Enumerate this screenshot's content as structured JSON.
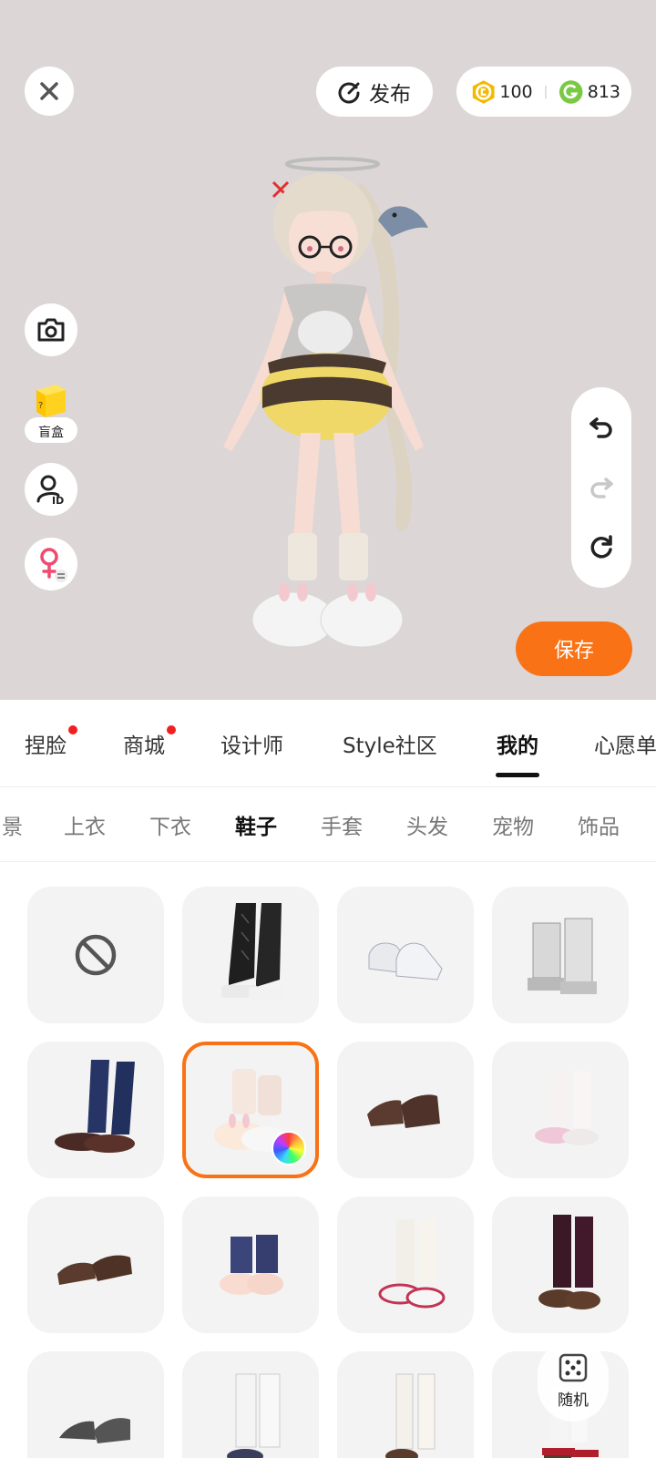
{
  "header": {
    "publish_label": "发布",
    "coin_gold": "100",
    "coin_green": "813"
  },
  "side": {
    "mystery_box_label": "盲盒"
  },
  "save_label": "保存",
  "main_tabs": [
    {
      "label": "捏脸",
      "dot": true
    },
    {
      "label": "商城",
      "dot": true
    },
    {
      "label": "设计师",
      "dot": false
    },
    {
      "label": "Style社区",
      "dot": false
    },
    {
      "label": "我的",
      "dot": false,
      "active": true
    },
    {
      "label": "心愿单",
      "dot": false
    }
  ],
  "sub_tabs": [
    {
      "label": "景"
    },
    {
      "label": "上衣"
    },
    {
      "label": "下衣"
    },
    {
      "label": "鞋子",
      "active": true
    },
    {
      "label": "手套"
    },
    {
      "label": "头发"
    },
    {
      "label": "宠物"
    },
    {
      "label": "饰品"
    }
  ],
  "grid_items": [
    {
      "kind": "none-icon"
    },
    {
      "kind": "black-lace-up-boots-icon"
    },
    {
      "kind": "white-sneakers-icon"
    },
    {
      "kind": "gray-mech-boots-icon"
    },
    {
      "kind": "navy-socks-loafers-icon"
    },
    {
      "kind": "bunny-slippers-icon",
      "selected": true
    },
    {
      "kind": "brown-loafers-icon"
    },
    {
      "kind": "pink-socks-shoes-icon"
    },
    {
      "kind": "brown-pumps-icon"
    },
    {
      "kind": "navy-sock-slippers-icon"
    },
    {
      "kind": "white-socks-red-sneakers-icon"
    },
    {
      "kind": "burgundy-socks-loafers-icon"
    },
    {
      "kind": "gray-heels-icon"
    },
    {
      "kind": "white-knee-socks-sneakers-icon"
    },
    {
      "kind": "white-socks-brown-shoes-icon"
    },
    {
      "kind": "geta-sandals-icon"
    }
  ],
  "random_label": "随机",
  "colors": {
    "accent": "#f97316",
    "stage_bg": "#ddd6d6",
    "gold_coin": "#f5b800",
    "green_coin": "#7ac943"
  }
}
